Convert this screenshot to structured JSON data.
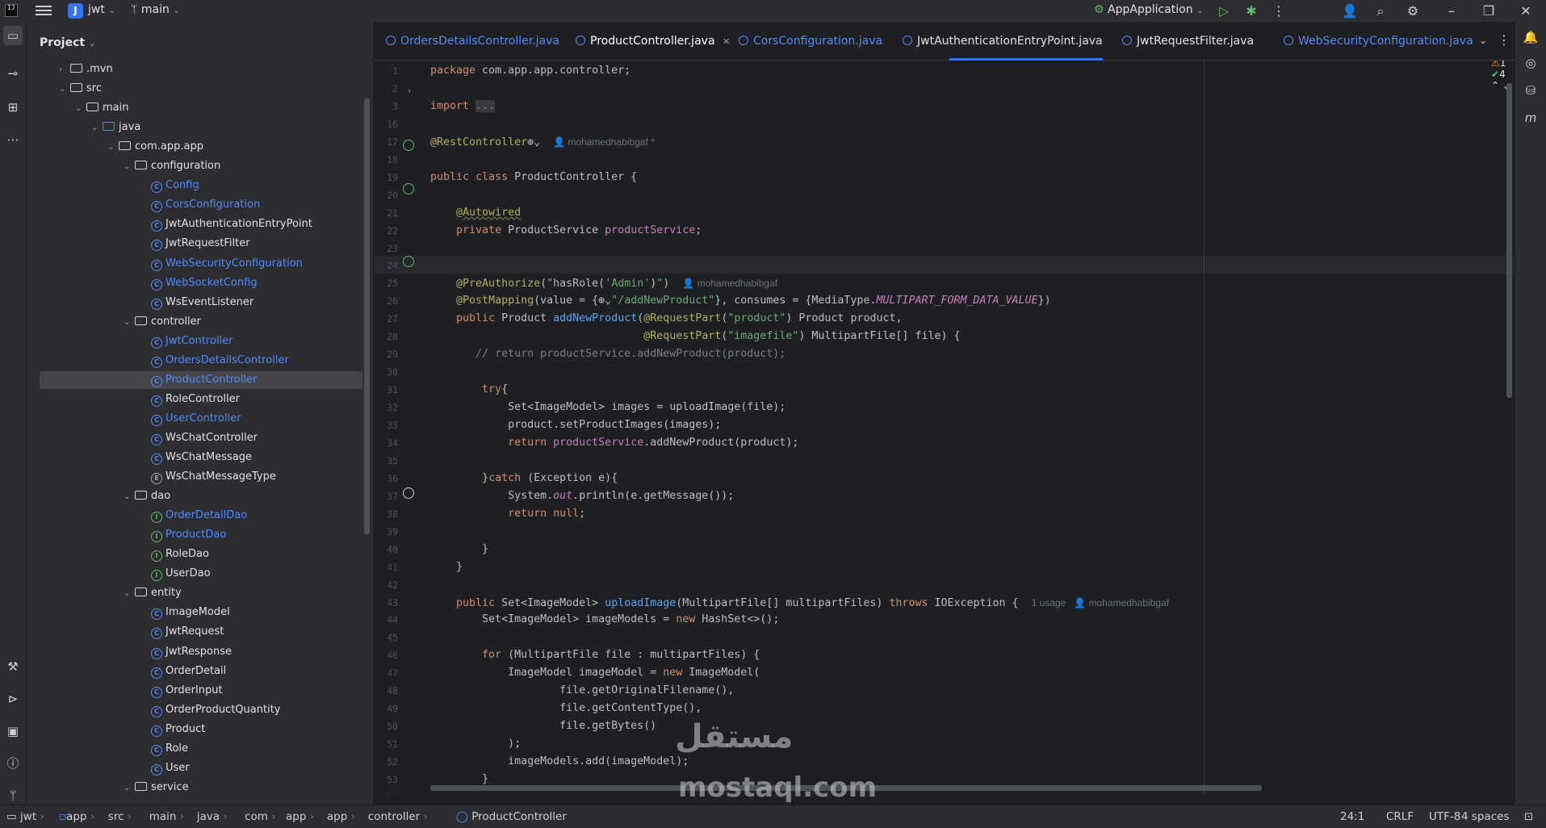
{
  "titlebar": {
    "project_letter": "J",
    "project_name": "jwt",
    "branch": "main",
    "run_config": "AppApplication"
  },
  "project_panel": {
    "title": "Project",
    "tree": [
      {
        "label": ".mvn",
        "kind": "folder",
        "depth": 2,
        "chevron": "right"
      },
      {
        "label": "src",
        "kind": "folder",
        "depth": 2,
        "chevron": "down"
      },
      {
        "label": "main",
        "kind": "folder",
        "depth": 3,
        "chevron": "down"
      },
      {
        "label": "java",
        "kind": "folder-blue",
        "depth": 4,
        "chevron": "down"
      },
      {
        "label": "com.app.app",
        "kind": "package",
        "depth": 5,
        "chevron": "down"
      },
      {
        "label": "configuration",
        "kind": "package",
        "depth": 6,
        "chevron": "down"
      },
      {
        "label": "Config",
        "kind": "class",
        "depth": 7,
        "color": "blue"
      },
      {
        "label": "CorsConfiguration",
        "kind": "class",
        "depth": 7,
        "color": "blue"
      },
      {
        "label": "JwtAuthenticationEntryPoint",
        "kind": "class",
        "depth": 7
      },
      {
        "label": "JwtRequestFilter",
        "kind": "class",
        "depth": 7
      },
      {
        "label": "WebSecurityConfiguration",
        "kind": "class",
        "depth": 7,
        "color": "blue"
      },
      {
        "label": "WebSocketConfig",
        "kind": "class",
        "depth": 7,
        "color": "blue"
      },
      {
        "label": "WsEventListener",
        "kind": "class",
        "depth": 7
      },
      {
        "label": "controller",
        "kind": "package",
        "depth": 6,
        "chevron": "down"
      },
      {
        "label": "JwtController",
        "kind": "class",
        "depth": 7,
        "color": "blue"
      },
      {
        "label": "OrdersDetailsController",
        "kind": "class",
        "depth": 7,
        "color": "blue"
      },
      {
        "label": "ProductController",
        "kind": "class",
        "depth": 7,
        "color": "blue",
        "selected": true
      },
      {
        "label": "RoleController",
        "kind": "class",
        "depth": 7
      },
      {
        "label": "UserController",
        "kind": "class",
        "depth": 7,
        "color": "blue"
      },
      {
        "label": "WsChatController",
        "kind": "class",
        "depth": 7
      },
      {
        "label": "WsChatMessage",
        "kind": "class",
        "depth": 7
      },
      {
        "label": "WsChatMessageType",
        "kind": "enum",
        "depth": 7
      },
      {
        "label": "dao",
        "kind": "package",
        "depth": 6,
        "chevron": "down"
      },
      {
        "label": "OrderDetailDao",
        "kind": "interface",
        "depth": 7,
        "color": "blue"
      },
      {
        "label": "ProductDao",
        "kind": "interface",
        "depth": 7,
        "color": "blue"
      },
      {
        "label": "RoleDao",
        "kind": "interface",
        "depth": 7
      },
      {
        "label": "UserDao",
        "kind": "interface",
        "depth": 7
      },
      {
        "label": "entity",
        "kind": "package",
        "depth": 6,
        "chevron": "down"
      },
      {
        "label": "ImageModel",
        "kind": "class",
        "depth": 7
      },
      {
        "label": "JwtRequest",
        "kind": "class",
        "depth": 7
      },
      {
        "label": "JwtResponse",
        "kind": "class",
        "depth": 7
      },
      {
        "label": "OrderDetail",
        "kind": "class",
        "depth": 7
      },
      {
        "label": "OrderInput",
        "kind": "class",
        "depth": 7
      },
      {
        "label": "OrderProductQuantity",
        "kind": "class",
        "depth": 7
      },
      {
        "label": "Product",
        "kind": "class",
        "depth": 7
      },
      {
        "label": "Role",
        "kind": "class",
        "depth": 7
      },
      {
        "label": "User",
        "kind": "class",
        "depth": 7
      },
      {
        "label": "service",
        "kind": "package",
        "depth": 6,
        "chevron": "down"
      }
    ]
  },
  "tabs": [
    {
      "label": "OrdersDetailsController.java",
      "color": "blue"
    },
    {
      "label": "ProductController.java",
      "active": true
    },
    {
      "label": "CorsConfiguration.java",
      "color": "blue"
    },
    {
      "label": "JwtAuthenticationEntryPoint.java"
    },
    {
      "label": "JwtRequestFilter.java"
    },
    {
      "label": "WebSecurityConfiguration.java",
      "color": "blue"
    }
  ],
  "editor": {
    "inspections": {
      "warnings": "1",
      "checks": "4"
    },
    "lines": [
      {
        "n": "1",
        "html": "<span class=\"kw\">package</span> com.app.app.controller;"
      },
      {
        "n": "2",
        "html": ""
      },
      {
        "n": "3",
        "html": "<span class=\"kw\">import</span> <span class=\"cm\" style=\"background:#393b40\">...</span>"
      },
      {
        "n": "16",
        "html": ""
      },
      {
        "n": "17",
        "html": "<span class=\"an\">@RestController</span>⊕⌄  <span class=\"hint\">👤 mohamedhabibgaf *</span>"
      },
      {
        "n": "18",
        "html": ""
      },
      {
        "n": "19",
        "html": "<span class=\"kw\">public class</span> ProductController {"
      },
      {
        "n": "20",
        "html": ""
      },
      {
        "n": "21",
        "html": "    <span class=\"an\" style=\"text-decoration:underline wavy #6f6a3f\">@Autowired</span>"
      },
      {
        "n": "22",
        "html": "    <span class=\"kw\">private</span> ProductService <span class=\"fld\">productService</span>;"
      },
      {
        "n": "23",
        "html": ""
      },
      {
        "n": "24",
        "html": ""
      },
      {
        "n": "25",
        "html": "    <span class=\"an\">@PreAuthorize</span>(<span class=\"str\">\"</span>hasRole(<span class=\"str\">'Admin'</span>)<span class=\"str\">\"</span>)  <span class=\"hint\">👤 mohamedhabibgaf</span>"
      },
      {
        "n": "26",
        "html": "    <span class=\"an\">@PostMapping</span>(value = {⊕⌄<span class=\"str\">\"/addNewProduct\"</span>}, consumes = {MediaType.<span class=\"ital\">MULTIPART_FORM_DATA_VALUE</span>})"
      },
      {
        "n": "27",
        "html": "    <span class=\"kw\">public</span> Product <span class=\"fn\">addNewProduct</span>(<span class=\"an\">@RequestPart</span>(<span class=\"str\">\"product\"</span>) Product product,"
      },
      {
        "n": "28",
        "html": "                                 <span class=\"an\">@RequestPart</span>(<span class=\"str\">\"imagefile\"</span>) MultipartFile[] file) {"
      },
      {
        "n": "29",
        "html": "       <span class=\"cm\">// return productService.addNewProduct(product);</span>"
      },
      {
        "n": "30",
        "html": ""
      },
      {
        "n": "31",
        "html": "        <span class=\"kw\">try</span>{"
      },
      {
        "n": "32",
        "html": "            Set&lt;ImageModel&gt; images = uploadImage(file);"
      },
      {
        "n": "33",
        "html": "            product.setProductImages(images);"
      },
      {
        "n": "34",
        "html": "            <span class=\"kw\">return</span> <span class=\"fld\">productService</span>.addNewProduct(product);"
      },
      {
        "n": "35",
        "html": ""
      },
      {
        "n": "36",
        "html": "        }<span class=\"kw\">catch</span> (Exception e){"
      },
      {
        "n": "37",
        "html": "            System.<span class=\"ital\">out</span>.println(e.getMessage());"
      },
      {
        "n": "38",
        "html": "            <span class=\"kw\">return null</span>;"
      },
      {
        "n": "39",
        "html": ""
      },
      {
        "n": "40",
        "html": "        }"
      },
      {
        "n": "41",
        "html": "    }"
      },
      {
        "n": "42",
        "html": ""
      },
      {
        "n": "43",
        "html": "    <span class=\"kw\">public</span> Set&lt;ImageModel&gt; <span class=\"fn\">uploadImage</span>(MultipartFile[] multipartFiles) <span class=\"kw\">throws</span> IOException {  <span class=\"hint\">1 usage   👤 mohamedhabibgaf</span>"
      },
      {
        "n": "44",
        "html": "        Set&lt;ImageModel&gt; imageModels = <span class=\"kw\">new</span> HashSet&lt;&gt;();"
      },
      {
        "n": "45",
        "html": ""
      },
      {
        "n": "46",
        "html": "        <span class=\"kw\">for</span> (MultipartFile file : multipartFiles) {"
      },
      {
        "n": "47",
        "html": "            ImageModel imageModel = <span class=\"kw\">new</span> ImageModel("
      },
      {
        "n": "48",
        "html": "                    file.getOriginalFilename(),"
      },
      {
        "n": "49",
        "html": "                    file.getContentType(),"
      },
      {
        "n": "50",
        "html": "                    file.getBytes()"
      },
      {
        "n": "51",
        "html": "            );"
      },
      {
        "n": "52",
        "html": "            imageModels.add(imageModel);"
      },
      {
        "n": "53",
        "html": "        }"
      },
      {
        "n": "54",
        "html": ""
      }
    ]
  },
  "watermark": {
    "arabic": "مستقل",
    "latin": "mostaql.com"
  },
  "statusbar": {
    "breadcrumbs": [
      "jwt",
      "app",
      "src",
      "main",
      "java",
      "com",
      "app",
      "app",
      "controller",
      "ProductController"
    ],
    "position": "24:1",
    "line_ending": "CRLF",
    "encoding": "UTF-8",
    "indent": "4 spaces"
  }
}
